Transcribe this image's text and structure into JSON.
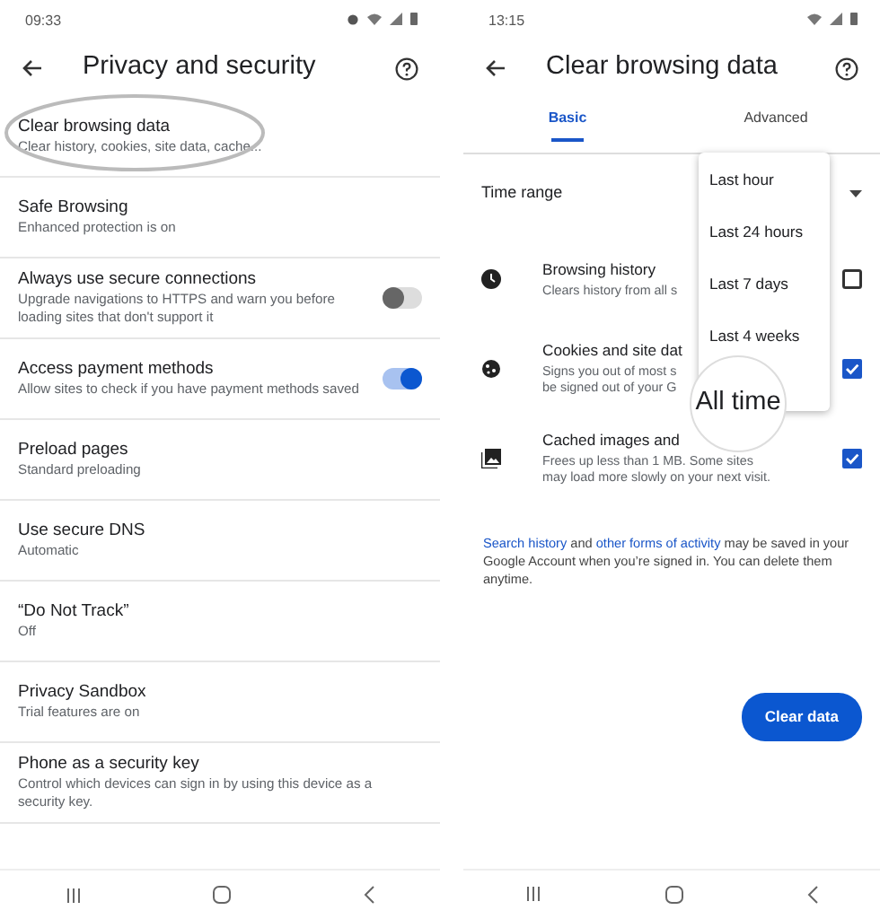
{
  "left_screen": {
    "status_time": "09:33",
    "header": {
      "title": "Privacy and security"
    },
    "items": [
      {
        "title": "Clear browsing data",
        "subtitle": "Clear history, cookies, site data, cache...",
        "kind": "plain",
        "highlighted": true
      },
      {
        "title": "Safe Browsing",
        "subtitle": "Enhanced protection is on",
        "kind": "plain",
        "highlighted": false
      },
      {
        "title": "Always use secure connections",
        "subtitle": "Upgrade navigations to HTTPS and warn you before loading sites that don't support it",
        "kind": "toggle",
        "on": false,
        "highlighted": false
      },
      {
        "title": "Access payment methods",
        "subtitle": "Allow sites to check if you have payment methods saved",
        "kind": "toggle",
        "on": true,
        "highlighted": false
      },
      {
        "title": "Preload pages",
        "subtitle": "Standard preloading",
        "kind": "plain",
        "highlighted": false
      },
      {
        "title": "Use secure DNS",
        "subtitle": "Automatic",
        "kind": "plain",
        "highlighted": false
      },
      {
        "title": "“Do Not Track”",
        "subtitle": "Off",
        "kind": "plain",
        "highlighted": false
      },
      {
        "title": "Privacy Sandbox",
        "subtitle": "Trial features are on",
        "kind": "plain",
        "highlighted": false
      },
      {
        "title": "Phone as a security key",
        "subtitle": "Control which devices can sign in by using this device as a security key.",
        "kind": "plain",
        "highlighted": false
      }
    ]
  },
  "right_screen": {
    "status_time": "13:15",
    "header": {
      "title": "Clear browsing data"
    },
    "tabs": [
      {
        "label": "Basic",
        "selected": true
      },
      {
        "label": "Advanced",
        "selected": false
      }
    ],
    "time_range": {
      "label": "Time range"
    },
    "data_types": [
      {
        "title": "Browsing history",
        "subtitle": "Clears history from all s",
        "checked": false
      },
      {
        "title": "Cookies and site dat",
        "subtitle": "Signs you out of most s\nbe signed out of your G",
        "checked": true
      },
      {
        "title": "Cached images and",
        "subtitle": "Frees up less than 1 MB. Some sites\nmay load more slowly on your next visit.",
        "checked": true
      }
    ],
    "dropdown": [
      {
        "label": "Last hour",
        "kind": "option"
      },
      {
        "label": "Last 24 hours",
        "kind": "option"
      },
      {
        "label": "Last 7 days",
        "kind": "option"
      },
      {
        "label": "Last 4 weeks",
        "kind": "option"
      },
      {
        "label": "All time",
        "kind": "magnified"
      }
    ],
    "note": [
      {
        "text": "Search history",
        "link": true
      },
      {
        "text": " and ",
        "link": false
      },
      {
        "text": "other forms of activity",
        "link": true
      },
      {
        "text": " may be saved in your Google Account when you’re signed in. You can delete them anytime.",
        "link": false
      }
    ],
    "button": "Clear data"
  }
}
